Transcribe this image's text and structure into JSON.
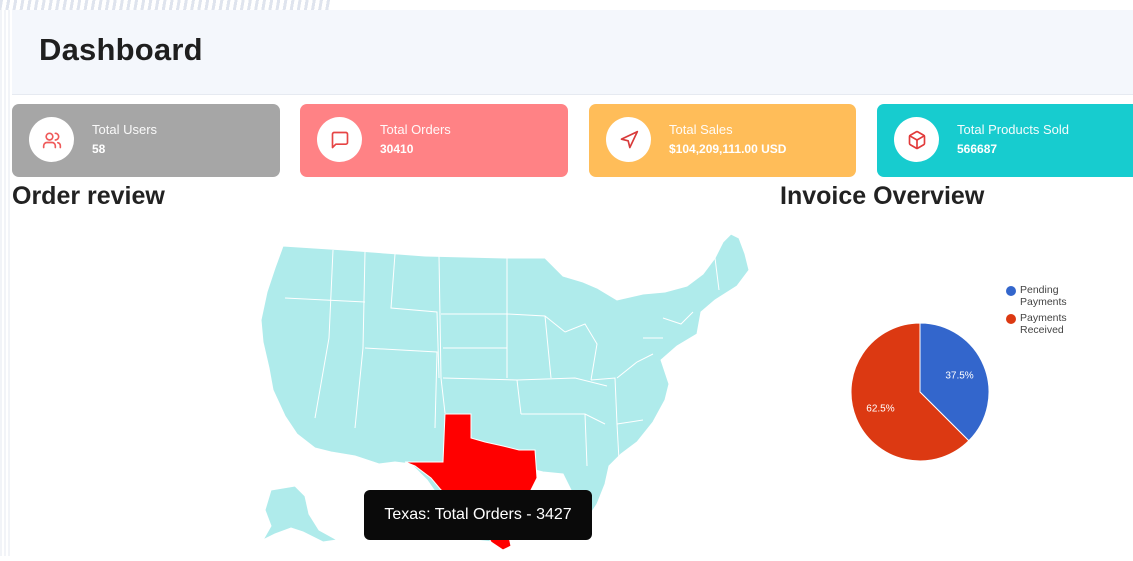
{
  "header": {
    "title": "Dashboard"
  },
  "stats": [
    {
      "label": "Total Users",
      "value": "58",
      "icon": "users-icon",
      "color": "#a6a6a6",
      "icon_color": "#ef5a5a"
    },
    {
      "label": "Total Orders",
      "value": "30410",
      "icon": "message-square-icon",
      "color": "#ff8285",
      "icon_color": "#e64545"
    },
    {
      "label": "Total Sales",
      "value": "$104,209,111.00 USD",
      "icon": "navigation-icon",
      "color": "#ffbd59",
      "icon_color": "#d83a3a"
    },
    {
      "label": "Total Products Sold",
      "value": "566687",
      "icon": "box-icon",
      "color": "#17cccf",
      "icon_color": "#e23a3a"
    }
  ],
  "order_review": {
    "title": "Order review",
    "map_fill": "#afebeb",
    "highlight_state": "Texas",
    "highlight_color": "#ff0000",
    "tooltip": "Texas: Total Orders - 3427"
  },
  "invoice_overview": {
    "title": "Invoice Overview",
    "legend": [
      {
        "label": "Pending Payments",
        "color": "#3366cc"
      },
      {
        "label": "Payments Received",
        "color": "#dc3912"
      }
    ]
  },
  "chart_data": {
    "type": "pie",
    "title": "",
    "categories": [
      "Pending Payments",
      "Payments Received"
    ],
    "values": [
      37.5,
      62.5
    ],
    "labels": [
      "37.5%",
      "62.5%"
    ],
    "colors": [
      "#3366cc",
      "#dc3912"
    ],
    "legend_position": "top-right"
  }
}
